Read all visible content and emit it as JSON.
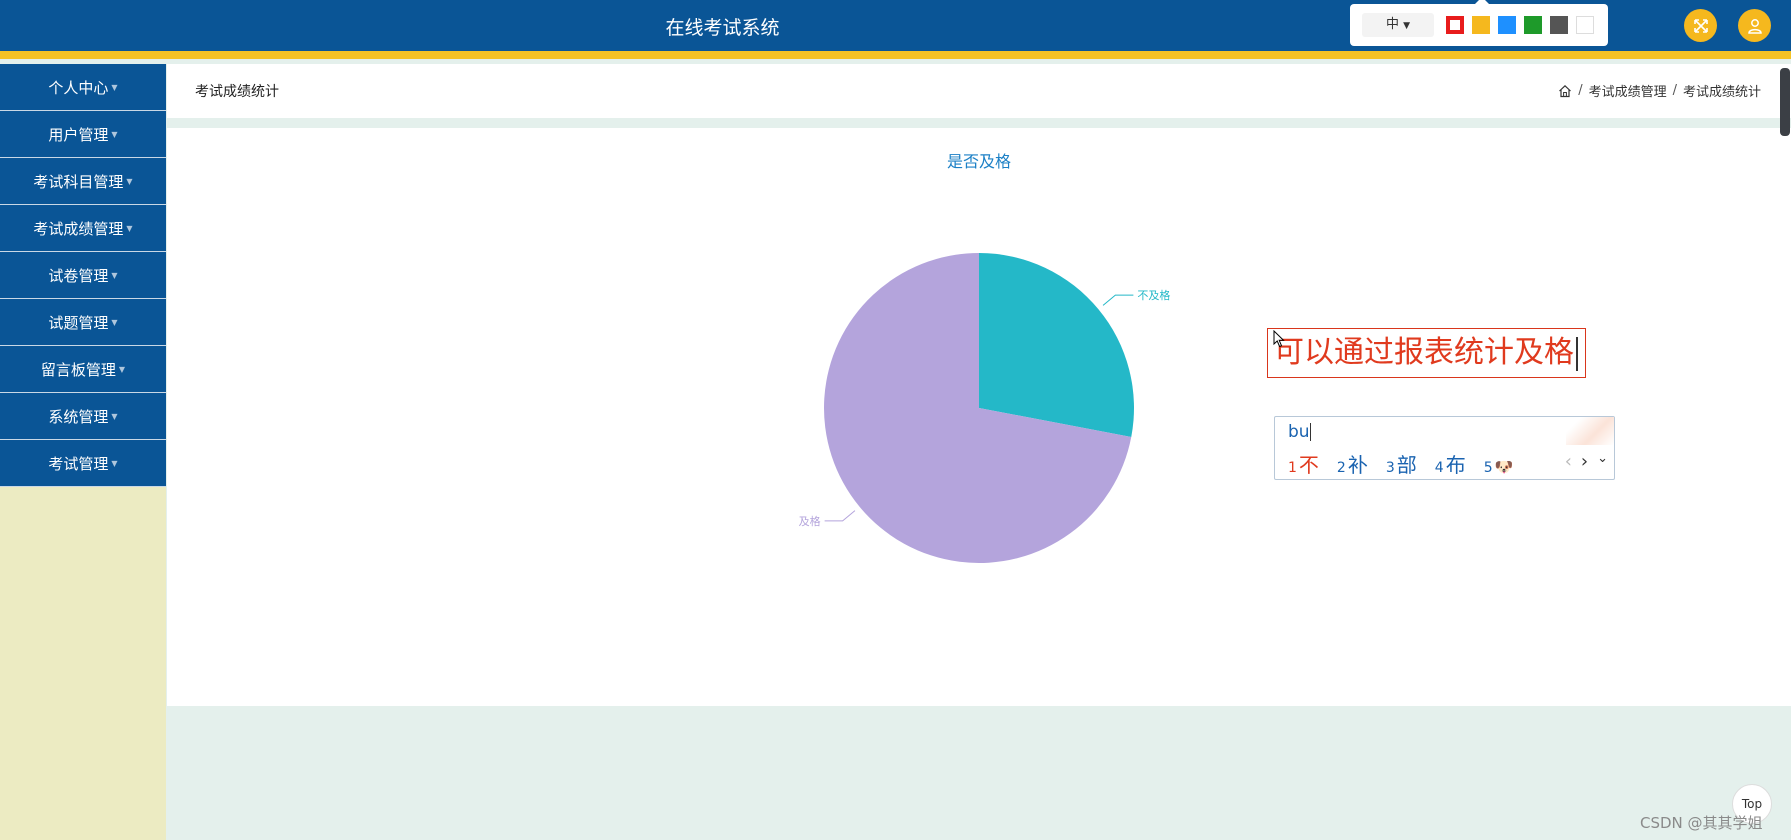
{
  "header": {
    "title": "在线考试系统",
    "lang_label": "中",
    "theme_colors": [
      "#e81c1c",
      "#f5b81e",
      "#1e90ff",
      "#1e9a2a",
      "#555555",
      "#ffffff"
    ],
    "fullscreen_icon": "expand-icon",
    "user_icon": "user-icon"
  },
  "sidebar": {
    "items": [
      {
        "label": "个人中心"
      },
      {
        "label": "用户管理"
      },
      {
        "label": "考试科目管理"
      },
      {
        "label": "考试成绩管理"
      },
      {
        "label": "试卷管理"
      },
      {
        "label": "试题管理"
      },
      {
        "label": "留言板管理"
      },
      {
        "label": "系统管理"
      },
      {
        "label": "考试管理"
      }
    ]
  },
  "page": {
    "title": "考试成绩统计",
    "breadcrumb": [
      "考试成绩管理",
      "考试成绩统计"
    ],
    "home_icon": "home-icon"
  },
  "chart_data": {
    "type": "pie",
    "title": "是否及格",
    "slices": [
      {
        "name": "不及格",
        "value": 28,
        "color": "#24b8c8"
      },
      {
        "name": "及格",
        "value": 72,
        "color": "#b4a4dc"
      }
    ]
  },
  "annotation": {
    "text": "可以通过报表统计及格"
  },
  "ime": {
    "input": "bu",
    "candidates": [
      {
        "num": "1",
        "text": "不"
      },
      {
        "num": "2",
        "text": "补"
      },
      {
        "num": "3",
        "text": "部"
      },
      {
        "num": "4",
        "text": "布"
      },
      {
        "num": "5",
        "text": "🐶"
      }
    ]
  },
  "top_button": "Top",
  "watermark": "CSDN @其其学姐"
}
